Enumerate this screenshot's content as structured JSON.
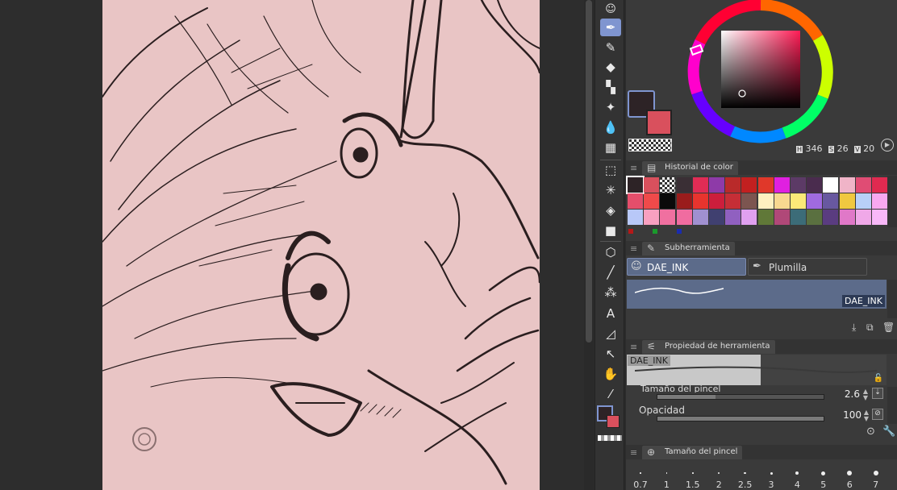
{
  "colors": {
    "main_color": "#2d2326",
    "sub_color": "#d9505d",
    "accent": "#7f95d0"
  },
  "color_wheel": {
    "h_value": "346",
    "s_value": "26",
    "v_value": "20",
    "h_icon": "h-icon",
    "s_icon": "s-icon",
    "v_icon": "v-icon"
  },
  "color_history": {
    "title": "Historial de color",
    "rows": [
      [
        "#2d2326",
        "#d9505d",
        "transparent",
        "#3a2f35",
        "#e02c55",
        "#8e3aa8",
        "#b92a2a",
        "#c22020",
        "#e0382a",
        "#e020e0",
        "#5c3a66",
        "#4a2c4e",
        "#ffffff",
        "#f0b4c8",
        "#e04c74",
        "#e02a50"
      ],
      [
        "#e54e6b",
        "#f04a4a",
        "#0a0a0a",
        "#9a1c1c",
        "#e8342e",
        "#cc1e3c",
        "#c62e36",
        "#7c5550",
        "#fef0c0",
        "#f8d890",
        "#fbe878",
        "#a06ae0",
        "#6858a0",
        "#f0c840",
        "#b8d0f8",
        "#f8a8f0"
      ],
      [
        "#b8c8f8",
        "#f8a0c0",
        "#f070a0",
        "#f06ca0",
        "#a090d0",
        "#404070",
        "#9060c0",
        "#e0a0f0",
        "#607838",
        "#b04878",
        "#3c6c78",
        "#5a7040",
        "#5a3c80",
        "#e078c8",
        "#f0a8e8",
        "#f8b8f8"
      ]
    ]
  },
  "subtool": {
    "title": "Subherramienta",
    "active_tab": "DAE_INK",
    "second_tab": "Plumilla",
    "brush_name": "DAE_INK"
  },
  "tool_property": {
    "title": "Propiedad de herramienta",
    "brush_name": "DAE_INK",
    "size_label": "Tamaño del pincel",
    "size_value": "2.6",
    "size_fraction": 0.35,
    "opacity_label": "Opacidad",
    "opacity_value": "100",
    "opacity_fraction": 1.0
  },
  "brush_size_panel": {
    "title": "Tamaño del pincel",
    "sizes": [
      "0.7",
      "1",
      "1.5",
      "2",
      "2.5",
      "3",
      "4",
      "5",
      "6",
      "7"
    ]
  },
  "toolbar": {
    "icons": [
      "dae-ink-icon",
      "pen-icon",
      "marker-icon",
      "eraser-icon",
      "blend-icon",
      "sparkle-icon",
      "drop-icon",
      "grid-icon",
      "lasso-icon",
      "magic-wand-icon",
      "fill-icon",
      "gradient-icon",
      "3d-box-icon",
      "line-icon",
      "speedline-icon",
      "text-icon",
      "frame-icon",
      "select-arrow-icon",
      "hand-icon",
      "eyedropper-icon"
    ]
  }
}
